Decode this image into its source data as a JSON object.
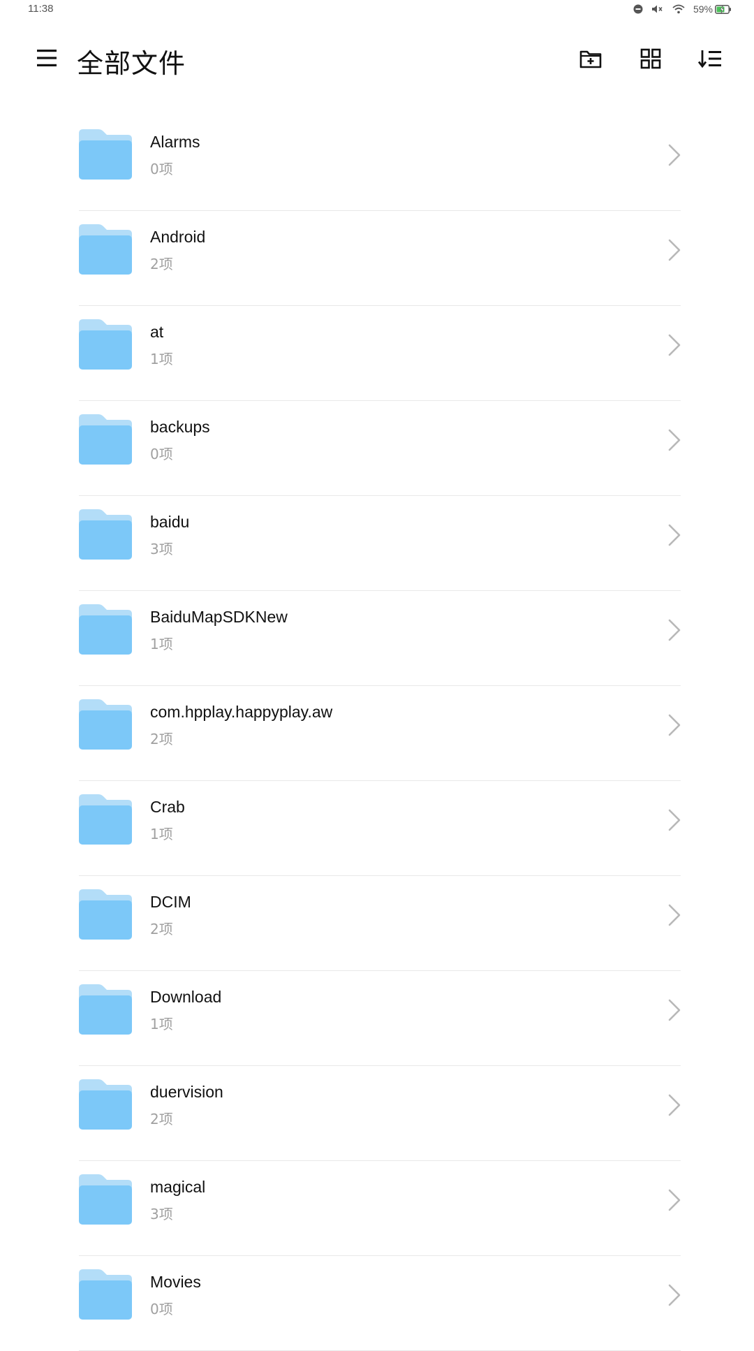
{
  "status_bar": {
    "time": "11:38",
    "battery_pct": "59%",
    "icons": [
      "do-not-disturb-icon",
      "mute-icon",
      "wifi-icon",
      "battery-charging-icon"
    ]
  },
  "header": {
    "title": "全部文件",
    "menu_icon": "menu-icon",
    "actions": [
      "new-folder-icon",
      "grid-view-icon",
      "sort-icon"
    ]
  },
  "colors": {
    "folder_front": "#7cc8f8",
    "folder_back": "#b3ddf8",
    "divider": "#e8e8e8",
    "secondary_text": "#a0a0a0",
    "chevron": "#b8b8b8"
  },
  "folders": [
    {
      "name": "Alarms",
      "count": "0项"
    },
    {
      "name": "Android",
      "count": "2项"
    },
    {
      "name": "at",
      "count": "1项"
    },
    {
      "name": "backups",
      "count": "0项"
    },
    {
      "name": "baidu",
      "count": "3项"
    },
    {
      "name": "BaiduMapSDKNew",
      "count": "1项"
    },
    {
      "name": "com.hpplay.happyplay.aw",
      "count": "2项"
    },
    {
      "name": "Crab",
      "count": "1项"
    },
    {
      "name": "DCIM",
      "count": "2项"
    },
    {
      "name": "Download",
      "count": "1项"
    },
    {
      "name": "duervision",
      "count": "2项"
    },
    {
      "name": "magical",
      "count": "3项"
    },
    {
      "name": "Movies",
      "count": "0项"
    }
  ]
}
